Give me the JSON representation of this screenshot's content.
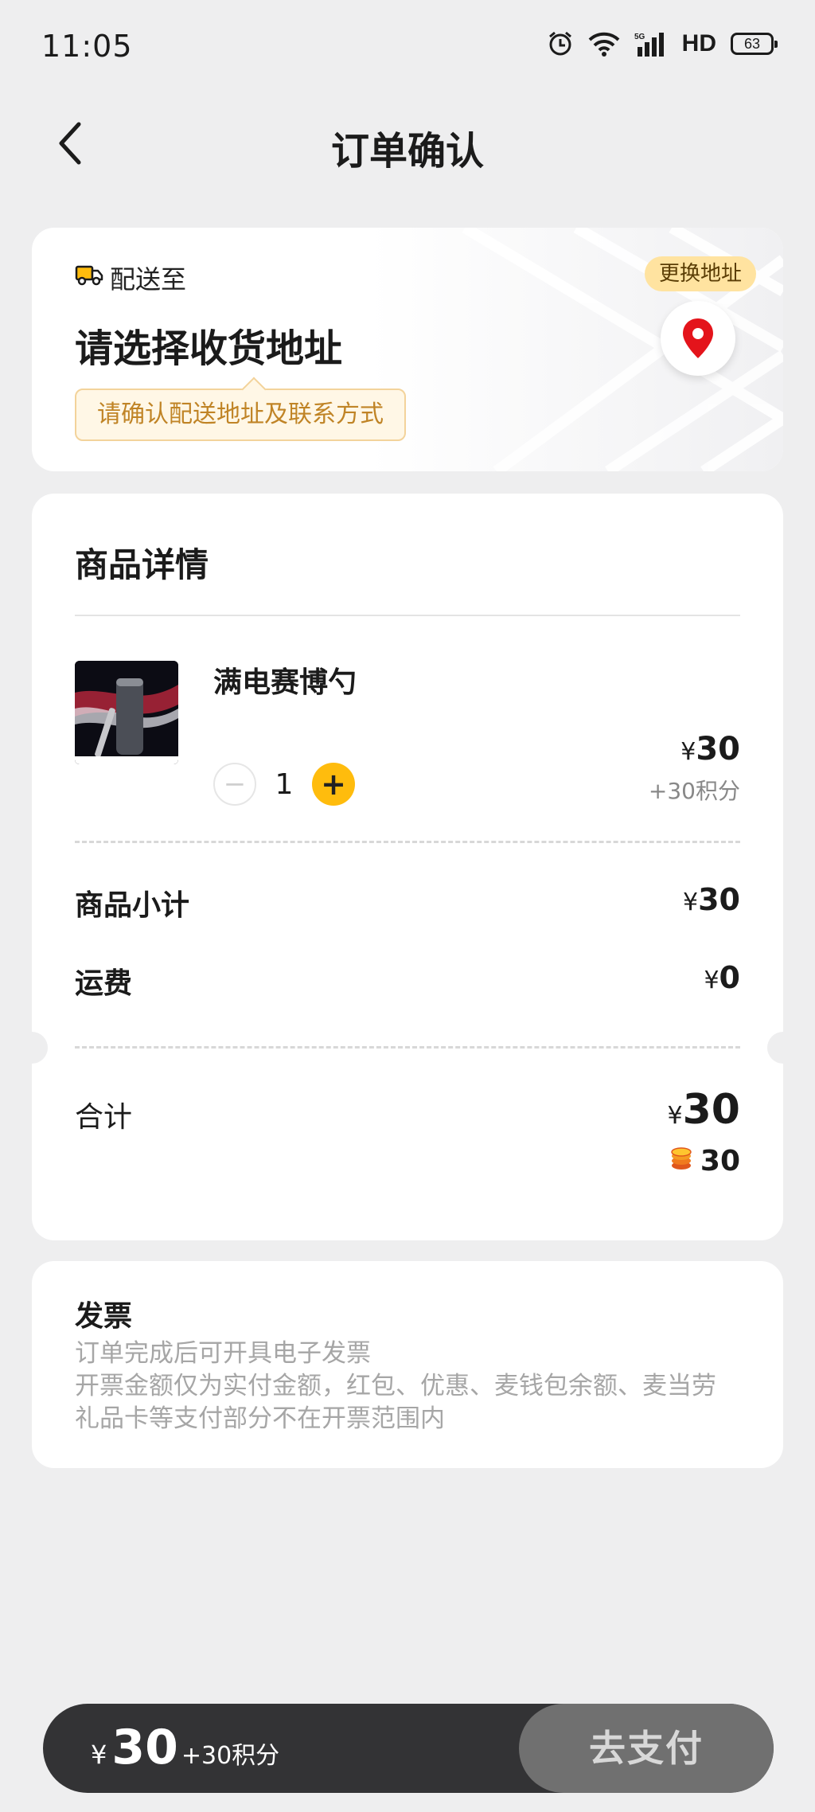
{
  "status_bar": {
    "time": "11:05",
    "network": "HD",
    "battery": "63"
  },
  "nav": {
    "title": "订单确认"
  },
  "address": {
    "deliver_label": "配送至",
    "title": "请选择收货地址",
    "hint": "请确认配送地址及联系方式",
    "change_button": "更换地址"
  },
  "products": {
    "section_title": "商品详情",
    "items": [
      {
        "name": "满电赛博勺",
        "quantity": "1",
        "currency": "¥",
        "price": "30",
        "points": "+30积分"
      }
    ],
    "subtotal_label": "商品小计",
    "subtotal_value": "30",
    "shipping_label": "运费",
    "shipping_value": "0",
    "total_label": "合计",
    "total_value": "30",
    "total_points": "30",
    "currency": "¥"
  },
  "invoice": {
    "title": "发票",
    "line1": "订单完成后可开具电子发票",
    "line2": "开票金额仅为实付金额，红包、优惠、麦钱包余额、麦当劳礼品卡等支付部分不在开票范围内"
  },
  "bottom_bar": {
    "currency": "¥",
    "amount": "30",
    "points": "+30积分",
    "pay_button": "去支付"
  },
  "colors": {
    "accent": "#ffbc0d",
    "map_pin": "#e4141b",
    "hint_text": "#c08426"
  }
}
